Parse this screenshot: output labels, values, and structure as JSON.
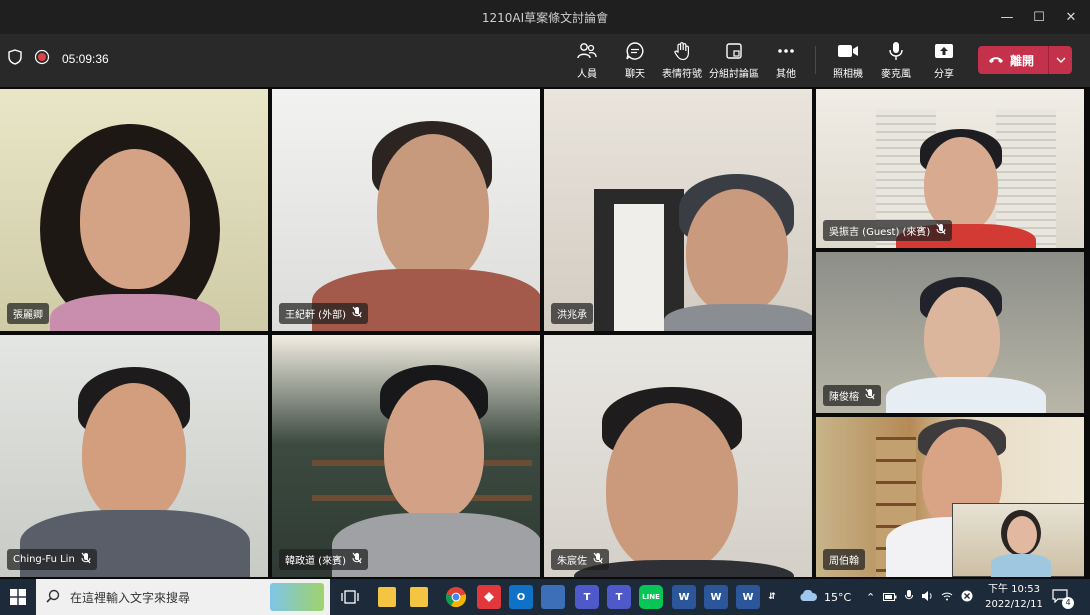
{
  "window": {
    "title": "1210AI草案條文討論會"
  },
  "meeting": {
    "timer": "05:09:36"
  },
  "toolbar": {
    "people": "人員",
    "chat": "聊天",
    "reactions": "表情符號",
    "breakout": "分組討論區",
    "more": "其他",
    "camera": "照相機",
    "mic": "麥克風",
    "share": "分享",
    "leave": "離開"
  },
  "participants": [
    {
      "name": "張麗卿",
      "muted": false
    },
    {
      "name": "王紀軒 (外部)",
      "muted": true
    },
    {
      "name": "洪兆承",
      "muted": false
    },
    {
      "name": "吳振吉 (Guest) (來賓)",
      "muted": true
    },
    {
      "name": "陳俊榕",
      "muted": true
    },
    {
      "name": "Ching-Fu Lin",
      "muted": true
    },
    {
      "name": "韓政道 (來賓)",
      "muted": true
    },
    {
      "name": "朱宸佐",
      "muted": true
    },
    {
      "name": "周伯翰",
      "muted": false
    }
  ],
  "taskbar": {
    "search_placeholder": "在這裡輸入文字來搜尋",
    "weather": "15°C",
    "time": "下午 10:53",
    "date": "2022/12/11",
    "notifications": "4"
  },
  "colors": {
    "leave": "#c4314b",
    "toolbar": "#292929",
    "titlebar": "#1f1f1f",
    "taskbar": "#1c2a3a"
  }
}
